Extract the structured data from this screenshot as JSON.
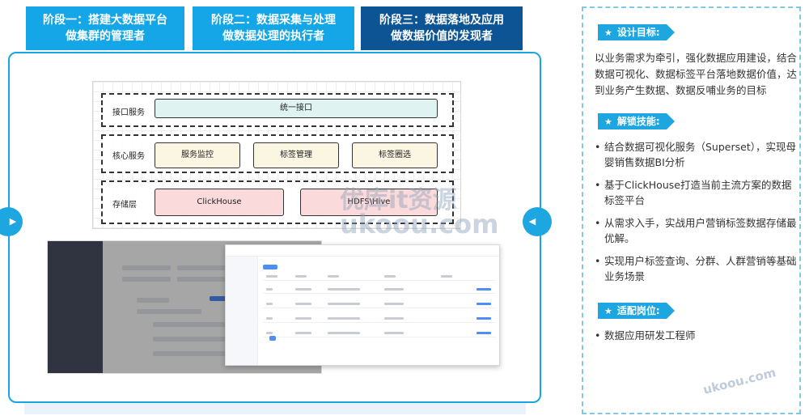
{
  "stages": [
    {
      "line1": "阶段一：搭建大数据平台",
      "line2": "做集群的管理者",
      "active": false
    },
    {
      "line1": "阶段二：数据采集与处理",
      "line2": "做数据处理的执行者",
      "active": false
    },
    {
      "line1": "阶段三：数据落地及应用",
      "line2": "做数据价值的发现者",
      "active": true
    }
  ],
  "nav": {
    "prev_icon": "play-right-icon",
    "next_icon": "play-left-icon"
  },
  "architecture": {
    "interface_layer": {
      "label": "接口服务",
      "boxes": [
        "统一接口"
      ]
    },
    "core_layer": {
      "label": "核心服务",
      "boxes": [
        "服务监控",
        "标签管理",
        "标签圈选"
      ]
    },
    "storage_layer": {
      "label": "存储层",
      "boxes": [
        "ClickHouse",
        "HDFS\\Hive"
      ]
    }
  },
  "watermark": {
    "cn": "优库it资源",
    "en": "ukoou.com",
    "corner": "ukoou.com"
  },
  "right_panel": {
    "goal": {
      "title": "设计目标:",
      "text": "以业务需求为牵引，强化数据应用建设，结合数据可视化、数据标签平台落地数据价值，达到业务产生数据、数据反哺业务的目标"
    },
    "skills": {
      "title": "解锁技能:",
      "items": [
        "结合数据可视化服务（Superset），实现母婴销售数据BI分析",
        "基于ClickHouse打造当前主流方案的数据标签平台",
        "从需求入手，实战用户营销标签数据存储最优解。",
        "实现用户标签查询、分群、人群营销等基础业务场景"
      ]
    },
    "jobs": {
      "title": "适配岗位:",
      "items": [
        "数据应用研发工程师"
      ]
    }
  },
  "colors": {
    "accent": "#1ea6e0",
    "dark_tab": "#0c5493",
    "light_tab": "#14a6e6"
  }
}
